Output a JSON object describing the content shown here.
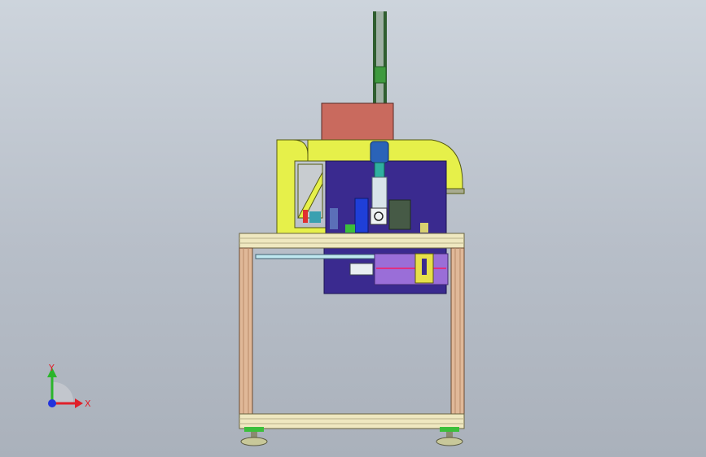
{
  "triad": {
    "x_label": "X",
    "y_label": "Y",
    "colors": {
      "x": "#e0202a",
      "y": "#2bb52b",
      "z": "#2233dd"
    }
  },
  "colors": {
    "frame_yellow": "#e6f04a",
    "plate_blue": "#3a2a8f",
    "motor_red": "#c96a5e",
    "table_top": "#efe8c0",
    "leg_wood": "#e0b898",
    "cylinder_blue": "#2a63b8",
    "guide_purple": "#9a6ed8",
    "belt_green": "#3f7f3f",
    "background": "#bcc3cd"
  }
}
